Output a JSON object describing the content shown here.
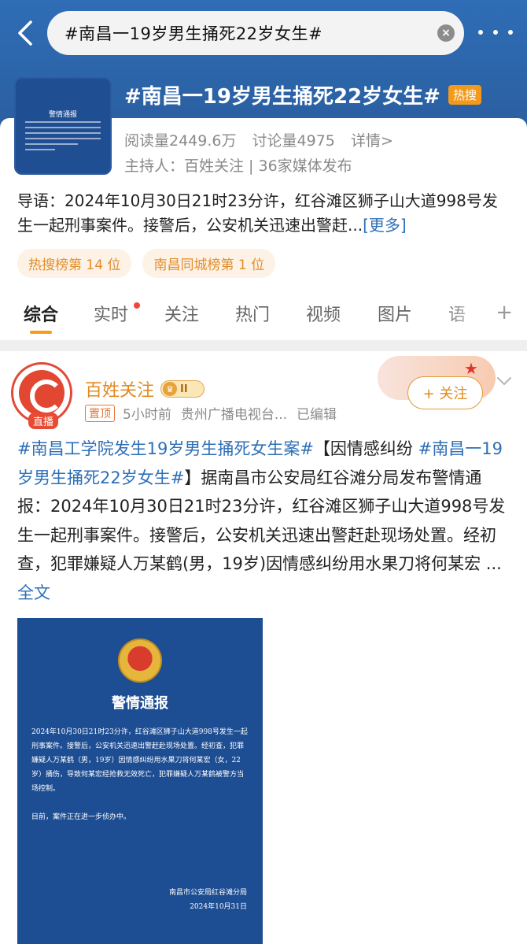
{
  "search": {
    "query": "#南昌一19岁男生捅死22岁女生#"
  },
  "icons": {
    "back": "chevron-left-icon",
    "clear": "clear-icon",
    "more": "more-dots-icon"
  },
  "colors": {
    "header_blue": "#2c64a8",
    "accent_orange": "#f59c1b",
    "link_blue": "#2e6fb7",
    "hot_orange": "#f39a1c"
  },
  "topic": {
    "title": "#南昌一19岁男生捅死22岁女生#",
    "hot_label": "热搜",
    "reads": "阅读量2449.6万",
    "discussions": "讨论量4975",
    "detail_link": "详情>",
    "host": "主持人：百姓关注 | 36家媒体发布",
    "thumb_title": "警情通报",
    "intro": "导语：2024年10月30日21时23分许，红谷滩区狮子山大道998号发生一起刑事案件。接警后，公安机关迅速出警赶...",
    "intro_more": "[更多]",
    "rank_tags": [
      "热搜榜第 14 位",
      "南昌同城榜第 1 位"
    ]
  },
  "tabs": [
    {
      "label": "综合",
      "active": true
    },
    {
      "label": "实时",
      "active": false
    },
    {
      "label": "关注",
      "active": false
    },
    {
      "label": "热门",
      "active": false
    },
    {
      "label": "视频",
      "active": false
    },
    {
      "label": "图片",
      "active": false
    },
    {
      "label": "语",
      "active": false
    }
  ],
  "tab_add": "+",
  "post": {
    "author": "百姓关注",
    "vip_level": "II",
    "live_badge": "直播",
    "pinned_label": "置顶",
    "time": "5小时前",
    "source": "贵州广播电视台...",
    "edited": "已编辑",
    "follow_label": "+ 关注",
    "tag1": "#南昌工学院发生19岁男生捅死女生案#",
    "text1": "【因情感纠纷 ",
    "tag2": "#南昌一19岁男生捅死22岁女生#",
    "text2": "】据南昌市公安局红谷滩分局发布警情通报：2024年10月30日21时23分许，红谷滩区狮子山大道998号发生一起刑事案件。接警后，公安机关迅速出警赶赴现场处置。经初查，犯罪嫌疑人万某鹤(男，19岁)因情感纠纷用水果刀将何某宏 ... ",
    "full_text_link": "全文"
  },
  "notice": {
    "title": "警情通报",
    "para1": "2024年10月30日21时23分许，红谷滩区狮子山大道998号发生一起刑事案件。接警后，公安机关迅速出警赶赴现场处置。经初查，犯罪嫌疑人万某鹤（男，19岁）因情感纠纷用水果刀将何某宏（女，22岁）捅伤，导致何某宏经抢救无效死亡，犯罪嫌疑人万某鹤被警方当场控制。",
    "para2": "目前，案件正在进一步侦办中。",
    "sign_org": "南昌市公安局红谷滩分局",
    "sign_date": "2024年10月31日"
  }
}
